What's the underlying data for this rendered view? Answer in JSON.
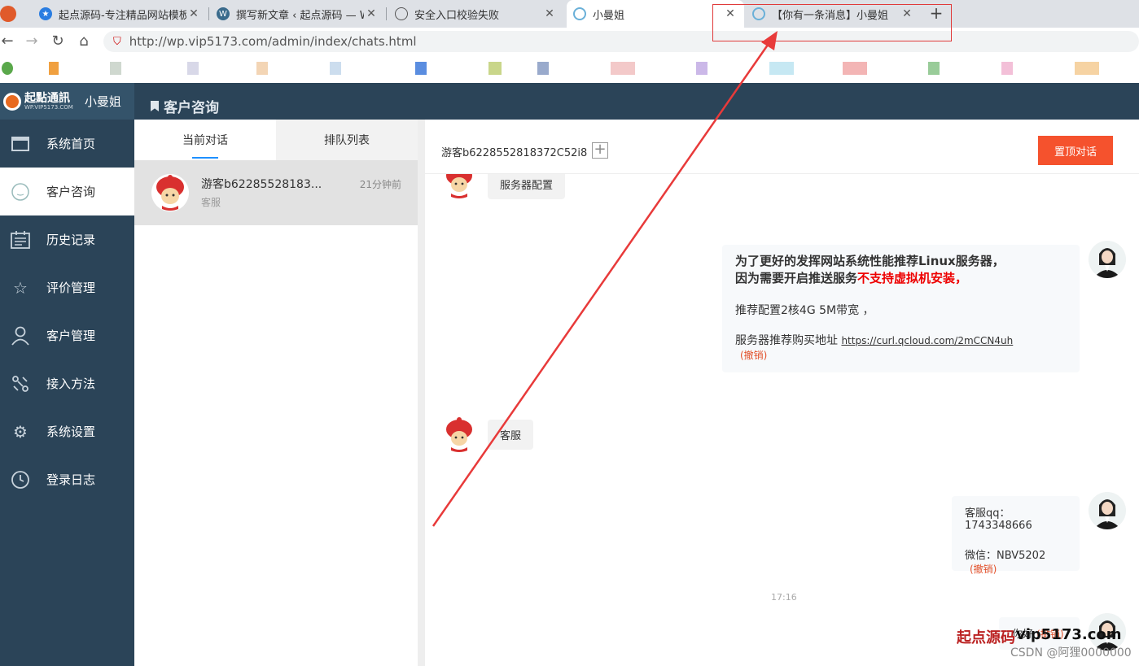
{
  "browser": {
    "tabs": [
      {
        "title": "起点源码-专注精品网站模板_"
      },
      {
        "title": "撰写新文章 ‹ 起点源码 — Wo"
      },
      {
        "title": "安全入口校验失败"
      },
      {
        "title": "小曼姐"
      },
      {
        "title": "【你有一条消息】小曼姐"
      }
    ],
    "url": "http://wp.vip5173.com/admin/index/chats.html"
  },
  "app": {
    "brand_name": "起點通訊",
    "brand_sub": "WP.VIP5173.COM",
    "user": "小曼姐",
    "page_title": "客户咨询"
  },
  "sidebar": {
    "items": [
      {
        "label": "系统首页",
        "icon": "window-icon"
      },
      {
        "label": "客户咨询",
        "icon": "chat-bubble-icon"
      },
      {
        "label": "历史记录",
        "icon": "calendar-list-icon"
      },
      {
        "label": "评价管理",
        "icon": "star-icon"
      },
      {
        "label": "客户管理",
        "icon": "user-icon"
      },
      {
        "label": "接入方法",
        "icon": "connect-icon"
      },
      {
        "label": "系统设置",
        "icon": "gear-icon"
      },
      {
        "label": "登录日志",
        "icon": "clock-icon"
      }
    ]
  },
  "conversations": {
    "tabs": [
      "当前对话",
      "排队列表"
    ],
    "items": [
      {
        "name": "游客b62285528183...",
        "time": "21分钟前",
        "last": "客服"
      }
    ]
  },
  "chat": {
    "guest": "游客b6228552818372C52i8",
    "pin_button": "置顶对话",
    "plus": "+",
    "messages": {
      "m1": "服务器配置",
      "m2_line1": "为了更好的发挥网站系统性能推荐Linux服务器，",
      "m2_line2a": "因为需要开启推送服务",
      "m2_line2b": "不支持虚拟机安装，",
      "m2_line3": "推荐配置2核4G 5M带宽 ，",
      "m2_line4": "服务器推荐购买地址 ",
      "m2_link": "https://curl.qcloud.com/2mCCN4uh",
      "revoke": "(撤销)",
      "m3": "客服",
      "m4_line1": "客服qq：1743348666",
      "m4_line2": "微信：NBV5202",
      "timestamp": "17:16",
      "m5": "你好"
    }
  },
  "watermark": {
    "brand_cn": "起点源码",
    "brand_en": "vip5173.com",
    "csdn": "CSDN @阿狸0000000"
  },
  "colors": {
    "sidebar_bg": "#2b4458",
    "accent_button": "#f5522d",
    "alert_red": "#e03a3a"
  }
}
